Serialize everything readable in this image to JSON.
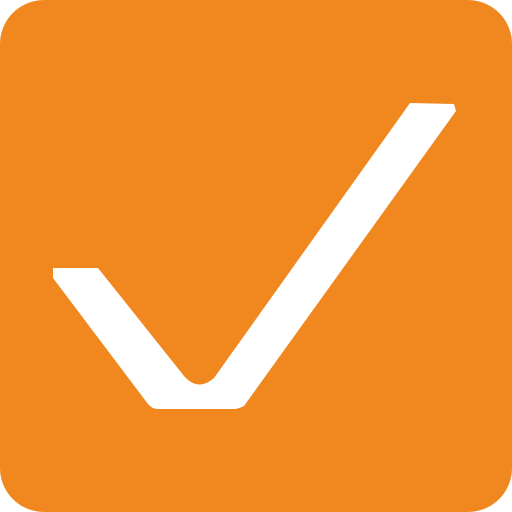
{
  "icon": {
    "name": "checkmark-icon",
    "background_color": "#F0871F",
    "mark_color": "#FFFFFF"
  }
}
